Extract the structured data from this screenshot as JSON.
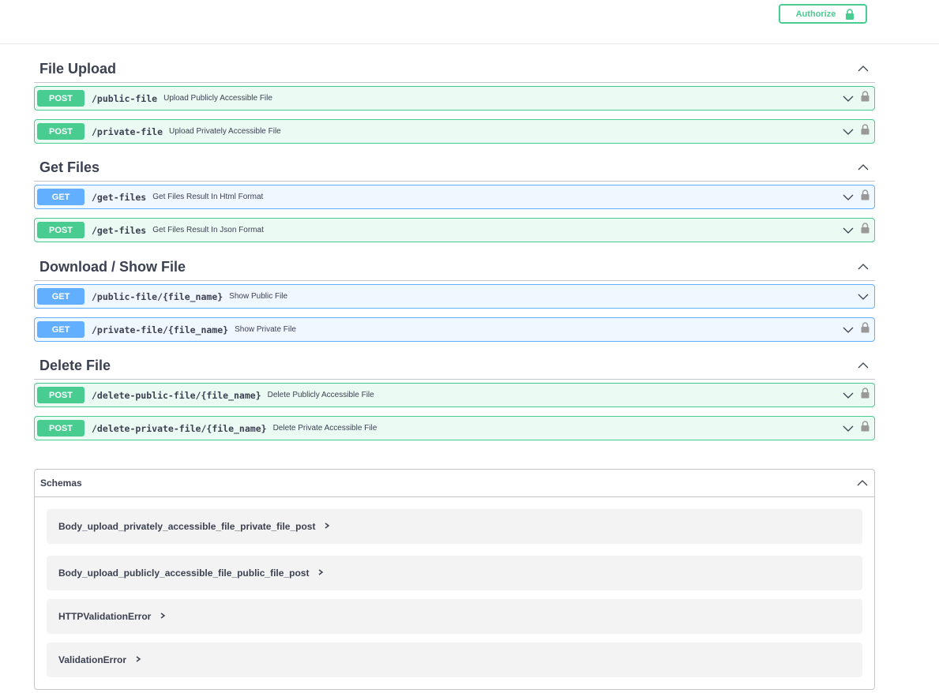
{
  "header": {
    "authorize_label": "Authorize",
    "lock_icon": "lock-icon"
  },
  "colors": {
    "post": "#49cc90",
    "get": "#61affe",
    "text": "#3b4151"
  },
  "sections": [
    {
      "title": "File Upload",
      "operations": [
        {
          "method": "POST",
          "path": "/public-file",
          "summary": "Upload Publicly Accessible File",
          "locked": true
        },
        {
          "method": "POST",
          "path": "/private-file",
          "summary": "Upload Privately Accessible File",
          "locked": true
        }
      ]
    },
    {
      "title": "Get Files",
      "operations": [
        {
          "method": "GET",
          "path": "/get-files",
          "summary": "Get Files Result In Html Format",
          "locked": true
        },
        {
          "method": "POST",
          "path": "/get-files",
          "summary": "Get Files Result In Json Format",
          "locked": true
        }
      ]
    },
    {
      "title": "Download / Show File",
      "operations": [
        {
          "method": "GET",
          "path": "/public-file/{file_name}",
          "summary": "Show Public File",
          "locked": false
        },
        {
          "method": "GET",
          "path": "/private-file/{file_name}",
          "summary": "Show Private File",
          "locked": true
        }
      ]
    },
    {
      "title": "Delete File",
      "operations": [
        {
          "method": "POST",
          "path": "/delete-public-file/{file_name}",
          "summary": "Delete Publicly Accessible File",
          "locked": true
        },
        {
          "method": "POST",
          "path": "/delete-private-file/{file_name}",
          "summary": "Delete Private Accessible File",
          "locked": true
        }
      ]
    }
  ],
  "schemas": {
    "title": "Schemas",
    "models": [
      "Body_upload_privately_accessible_file_private_file_post",
      "Body_upload_publicly_accessible_file_public_file_post",
      "HTTPValidationError",
      "ValidationError"
    ]
  }
}
